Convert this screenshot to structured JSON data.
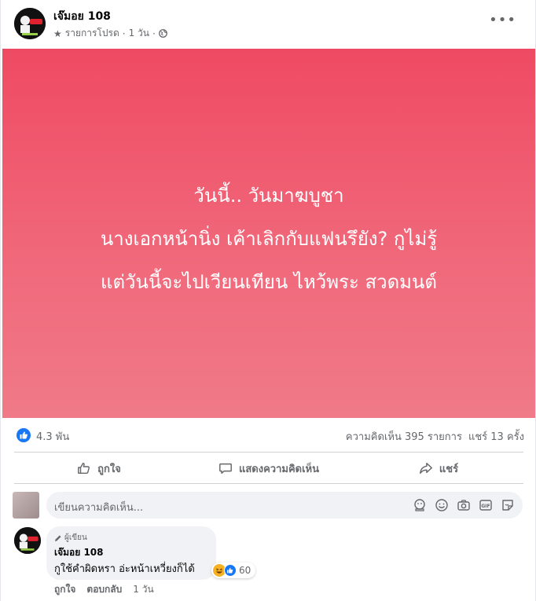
{
  "post": {
    "page_name": "เจ๊มอย 108",
    "meta_favorites": "รายการโปรด",
    "meta_sep1": "·",
    "meta_time": "1 วัน",
    "meta_sep2": "·",
    "more_label": "•••",
    "image_text": [
      "วันนี้.. วันมาฆบูชา",
      "นางเอกหน้านิ่ง เค้าเลิกกับแฟนรึยัง? กูไม่รู้",
      "แต่วันนี้จะไปเวียนเทียน ไหว้พระ สวดมนต์"
    ],
    "gradient": [
      "#ef4a63",
      "#f07a88"
    ]
  },
  "stats": {
    "reactions": "4.3 พัน",
    "comments": "ความคิดเห็น 395 รายการ",
    "shares": "แชร์ 13 ครั้ง"
  },
  "actions": {
    "like": "ถูกใจ",
    "comment": "แสดงความคิดเห็น",
    "share": "แชร์"
  },
  "composer": {
    "placeholder": "เขียนความคิดเห็น..."
  },
  "comment": {
    "badge": "ผู้เขียน",
    "author": "เจ๊มอย 108",
    "text": "กูใช้คำผิดหรา อ่ะหน้าเหวี่ยงก็ได้",
    "reaction_count": "60",
    "like": "ถูกใจ",
    "reply": "ตอบกลับ",
    "time": "1 วัน"
  },
  "colors": {
    "accent": "#1877f2",
    "muted": "#65676b"
  }
}
